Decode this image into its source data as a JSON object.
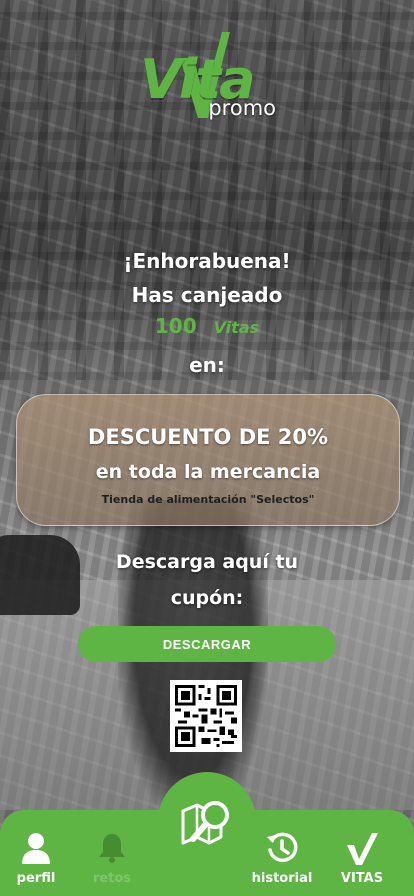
{
  "brand": {
    "logo_text": "Vita",
    "logo_sub": "promo"
  },
  "message": {
    "line1": "¡Enhorabuena!",
    "line2": "Has canjeado",
    "points_value": "100",
    "points_unit": "Vitas",
    "line3": "en:"
  },
  "offer": {
    "title": "DESCUENTO DE 20%",
    "subtitle": "en toda la mercancia",
    "store": "Tienda de alimentación \"Selectos\""
  },
  "download": {
    "text_line1": "Descarga aquí tu",
    "text_line2": "cupón:",
    "button_label": "DESCARGAR"
  },
  "nav": {
    "items": [
      {
        "label": "perfil",
        "icon": "person-icon"
      },
      {
        "label": "retos",
        "icon": "bell-icon"
      },
      {
        "label": "historial",
        "icon": "history-icon"
      },
      {
        "label": "VITAS",
        "icon": "checkmark-icon"
      }
    ],
    "center_icon": "map-search-icon"
  },
  "colors": {
    "accent": "#5fb544",
    "text": "#ffffff"
  }
}
